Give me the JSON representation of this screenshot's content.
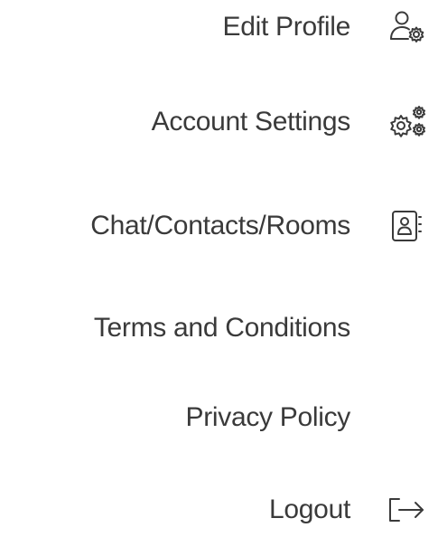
{
  "menu": {
    "items": [
      {
        "label": "Edit Profile",
        "icon": "user-settings-icon"
      },
      {
        "label": "Account Settings",
        "icon": "gears-icon"
      },
      {
        "label": "Chat/Contacts/Rooms",
        "icon": "contact-book-icon"
      },
      {
        "label": "Terms and Conditions",
        "icon": ""
      },
      {
        "label": "Privacy Policy",
        "icon": ""
      },
      {
        "label": "Logout",
        "icon": "logout-icon"
      }
    ]
  },
  "colors": {
    "text": "#3a3a3a",
    "icon": "#3a3a3a",
    "background": "#ffffff"
  }
}
